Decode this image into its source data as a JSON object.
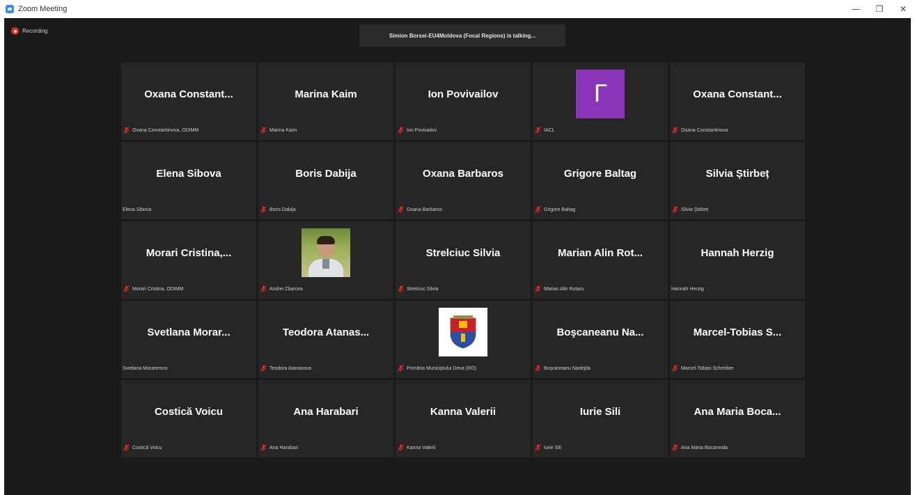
{
  "window": {
    "title": "Zoom Meeting",
    "minimize": "—",
    "restore": "❐",
    "close": "✕"
  },
  "recording": {
    "label": "Recording"
  },
  "talking_banner": "Simion Borsei-EU4Moldova (Focal Regions) is talking...",
  "participants": [
    {
      "display": "Oxana  Constant...",
      "name": "Oxana Constantinova, ODIMM",
      "muted": true,
      "avatar": "text"
    },
    {
      "display": "Marina Kaim",
      "name": "Marina Kaim",
      "muted": true,
      "avatar": "text"
    },
    {
      "display": "Ion Povivailov",
      "name": "Ion Povivailov",
      "muted": true,
      "avatar": "text"
    },
    {
      "display": "Γ",
      "name": "IACL",
      "muted": true,
      "avatar": "letter"
    },
    {
      "display": "Oxana  Constant...",
      "name": "Oxana Constantinova",
      "muted": true,
      "avatar": "text"
    },
    {
      "display": "Elena Sibova",
      "name": "Elena Sibova",
      "muted": false,
      "avatar": "text"
    },
    {
      "display": "Boris Dabija",
      "name": "Boris Dabija",
      "muted": true,
      "avatar": "text"
    },
    {
      "display": "Oxana Barbaros",
      "name": "Oxana Barbaros",
      "muted": true,
      "avatar": "text"
    },
    {
      "display": "Grigore Baltag",
      "name": "Grigore Baltag",
      "muted": true,
      "avatar": "text"
    },
    {
      "display": "Silvia Știrbeț",
      "name": "Silvia Știrbeț",
      "muted": true,
      "avatar": "text"
    },
    {
      "display": "Morari  Cristina,...",
      "name": "Morari Cristina, ODIMM",
      "muted": true,
      "avatar": "text"
    },
    {
      "display": "",
      "name": "Andrei Zbarcea",
      "muted": true,
      "avatar": "photo"
    },
    {
      "display": "Strelciuc Silvia",
      "name": "Strelciuc Silvia",
      "muted": true,
      "avatar": "text"
    },
    {
      "display": "Marian  Alin  Rot...",
      "name": "Marian Alin Rotaru",
      "muted": true,
      "avatar": "text"
    },
    {
      "display": "Hannah Herzig",
      "name": "Hannah Herzig",
      "muted": false,
      "avatar": "text"
    },
    {
      "display": "Svetlana  Morar...",
      "name": "Svetlana Moraremco",
      "muted": false,
      "avatar": "text"
    },
    {
      "display": "Teodora  Atanas...",
      "name": "Teodora Atanasova",
      "muted": true,
      "avatar": "text"
    },
    {
      "display": "",
      "name": "Primăria Municipiului Deva (RO)",
      "muted": true,
      "avatar": "crest"
    },
    {
      "display": "Boşcaneanu  Na...",
      "name": "Boşcaneanu Nadejda",
      "muted": true,
      "avatar": "text"
    },
    {
      "display": "Marcel-Tobias  S...",
      "name": "Marcel-Tobias Schreiber",
      "muted": true,
      "avatar": "text"
    },
    {
      "display": "Costică Voicu",
      "name": "Costică Voicu",
      "muted": true,
      "avatar": "text"
    },
    {
      "display": "Ana Harabari",
      "name": "Ana Harabari",
      "muted": true,
      "avatar": "text"
    },
    {
      "display": "Kanna Valerii",
      "name": "Kanna Valerii",
      "muted": true,
      "avatar": "text"
    },
    {
      "display": "Iurie Sili",
      "name": "Iurie Sili",
      "muted": true,
      "avatar": "text"
    },
    {
      "display": "Ana  Maria  Boca...",
      "name": "Ana Maria Bocaneala",
      "muted": true,
      "avatar": "text"
    }
  ],
  "colors": {
    "background": "#1a1a1a",
    "tile": "#262626",
    "muted_icon": "#e02828",
    "avatar_purple": "#8a35b8",
    "zoom_blue": "#2d8cff"
  }
}
